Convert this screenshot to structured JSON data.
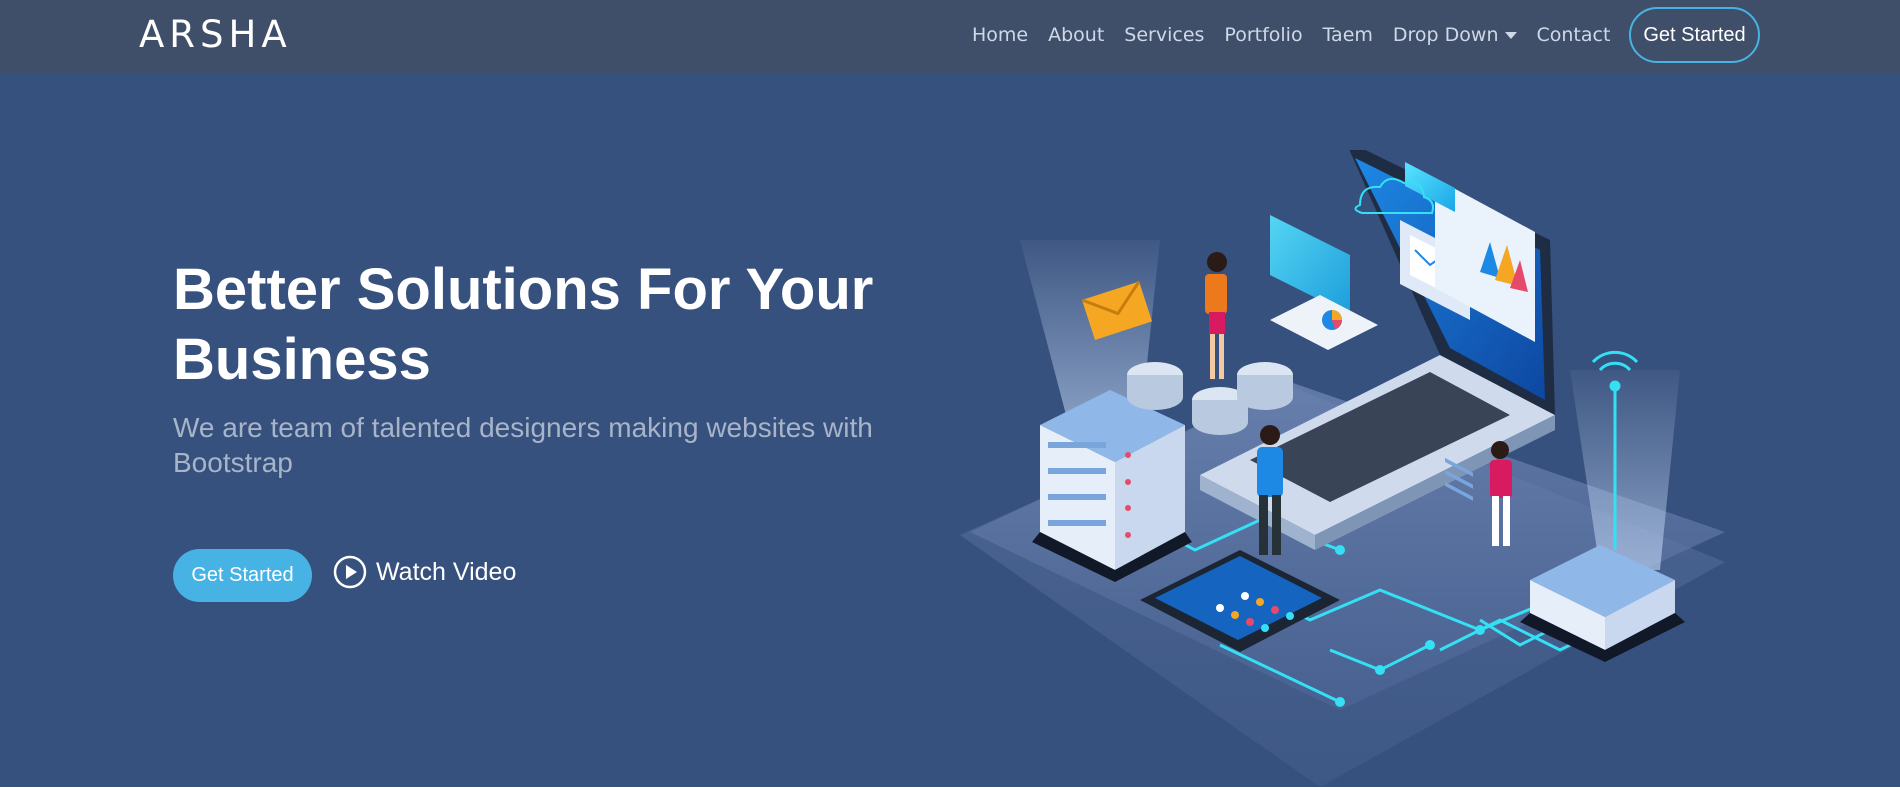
{
  "header": {
    "logo": "ARSHA",
    "nav": [
      {
        "label": "Home"
      },
      {
        "label": "About"
      },
      {
        "label": "Services"
      },
      {
        "label": "Portfolio"
      },
      {
        "label": "Taem"
      },
      {
        "label": "Drop Down",
        "has_dropdown": true
      },
      {
        "label": "Contact"
      }
    ],
    "cta_label": "Get Started"
  },
  "hero": {
    "title_line1": "Better Solutions For Your",
    "title_line2": "Business",
    "subtitle": "We are team of talented designers making websites with Bootstrap",
    "primary_button": "Get Started",
    "secondary_button": "Watch Video",
    "secondary_icon": "play-circle-icon",
    "illustration": "isometric-tech-illustration"
  },
  "colors": {
    "page_bg": "#37517e",
    "header_bg": "#3f4f69",
    "accent": "#47b2e4",
    "text_light": "#ffffff",
    "text_muted": "#a8b4c8",
    "nav_text": "#cfd8e8"
  }
}
